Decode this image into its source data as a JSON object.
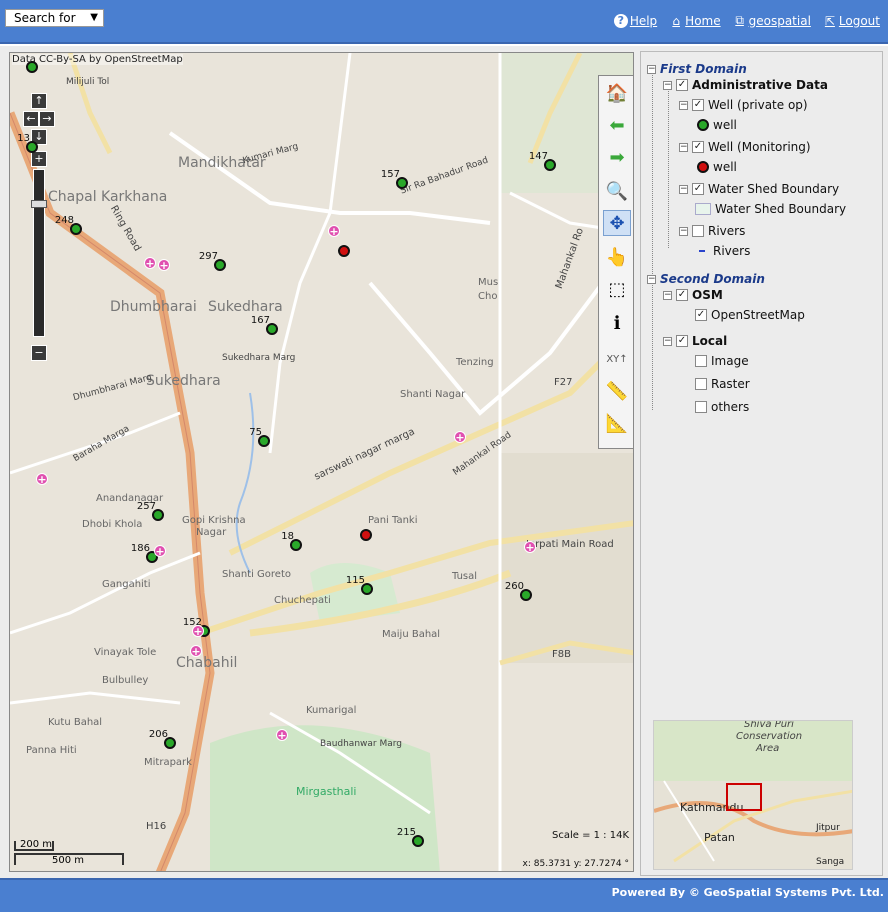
{
  "header": {
    "search_label": "Search for",
    "links": {
      "help": "Help",
      "home": "Home",
      "geospatial": "geospatial",
      "logout": "Logout"
    }
  },
  "map": {
    "attribution": "Data CC-By-SA by OpenStreetMap",
    "scale": "Scale = 1 : 14K",
    "coords": "x: 85.3731  y: 27.7274 °",
    "scalebar_small": "200 m",
    "scalebar_large": "500 m",
    "places": {
      "mandikhatar": "Mandikhatar",
      "chapal_karkhana": "Chapal Karkhana",
      "dhumbharai": "Dhumbharai",
      "sukedhara_top": "Sukedhara",
      "sukedhara": "Sukedhara",
      "dhumbharai_marga": "Dhumbharai Marg",
      "baraha_marga": "Baraha Marga",
      "anandanagar": "Anandanagar",
      "dhobi_khola": "Dhobi Khola",
      "gopi_krishna": "Gopi Krishna",
      "nagar": "Nagar",
      "gangahiti": "Gangahiti",
      "shanti_goreto": "Shanti Goreto",
      "chuchepati": "Chuchepati",
      "vinayak_tole": "Vinayak Tole",
      "chabahil": "Chabahil",
      "bulbulley": "Bulbulley",
      "kutu_bahal": "Kutu Bahal",
      "panna_hiti": "Panna Hiti",
      "mitrapark": "Mitrapark",
      "kumarigal": "Kumarigal",
      "mirgasthali": "Mirgasthali",
      "maiju_bahal": "Maiju Bahal",
      "tusal": "Tusal",
      "pani_tanki": "Pani Tanki",
      "shanti_nagar": "Shanti Nagar",
      "tenzing": "Tenzing",
      "jorpati_road": "Jorpati Main Road",
      "mahankal_road": "Mahankal Road",
      "saraswati_marg": "sarswati nagar marga",
      "ring_road": "Ring Road",
      "kumari_marg": "Kumari Marg",
      "sir_ra_road": "Sir Ra Bahadur Road",
      "milijuli": "Milijuli Tol",
      "mahankal_rd2": "Mahankal Ro",
      "f27": "F27",
      "f8b": "F8B",
      "h16": "H16",
      "mus": "Mus",
      "cho": "Cho",
      "sukedhara_marg": "Sukedhara Marg",
      "baudhanath_marg": "Baudhanwar Marg",
      "dhobi": "Dhobi"
    },
    "wells": [
      {
        "id": "13",
        "type": "private"
      },
      {
        "id": "248",
        "type": "private"
      },
      {
        "id": "297",
        "type": "private"
      },
      {
        "id": "157",
        "type": "private"
      },
      {
        "id": "147",
        "type": "private"
      },
      {
        "id": "167",
        "type": "private"
      },
      {
        "id": "75",
        "type": "private"
      },
      {
        "id": "257",
        "type": "private"
      },
      {
        "id": "186",
        "type": "private"
      },
      {
        "id": "18",
        "type": "private"
      },
      {
        "id": "115",
        "type": "private"
      },
      {
        "id": "260",
        "type": "private"
      },
      {
        "id": "152",
        "type": "private"
      },
      {
        "id": "206",
        "type": "private"
      },
      {
        "id": "215",
        "type": "private"
      }
    ]
  },
  "layers": {
    "first_domain": "First Domain",
    "admin": "Administrative Data",
    "well_private": "Well (private op)",
    "well_private_legend": "well",
    "well_monitoring": "Well (Monitoring)",
    "well_monitoring_legend": "well",
    "watershed": "Water Shed Boundary",
    "watershed_legend": "Water Shed Boundary",
    "rivers": "Rivers",
    "rivers_legend": "Rivers",
    "second_domain": "Second Domain",
    "osm": "OSM",
    "openstreetmap": "OpenStreetMap",
    "local": "Local",
    "image": "Image",
    "raster": "Raster",
    "others": "others"
  },
  "overview": {
    "kathmandu": "Kathmandu",
    "patan": "Patan",
    "shiva_puri": "Shiva Puri",
    "conservation": "Conservation",
    "area": "Area",
    "jitpur": "Jitpur",
    "sanga": "Sanga"
  },
  "footer": {
    "text": "Powered By © GeoSpatial Systems Pvt. Ltd."
  },
  "colors": {
    "header": "#4a7fd0",
    "ring_road": "#e8a878",
    "well_private": "#2aa82a",
    "well_monitoring": "#d01010",
    "hospital": "#e050b0"
  }
}
